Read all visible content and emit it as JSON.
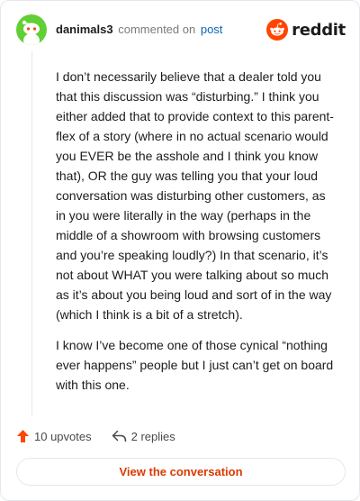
{
  "header": {
    "username": "danimals3",
    "action": "commented on",
    "post_link": "post",
    "brand": "reddit"
  },
  "comment": {
    "paragraphs": [
      "I don’t necessarily believe that a dealer told you that this discussion was “disturbing.” I think you either added that to provide context to this parent-flex of a story (where in no actual scenario would you EVER be the asshole and I think you know that), OR the guy was telling you that your loud conversation was disturbing other customers, as in you were literally in the way (perhaps in the middle of a showroom with browsing customers and you’re speaking loudly?) In that scenario, it’s not about WHAT you were talking about so much as it’s about you being loud and sort of in the way (which I think is a bit of a stretch).",
      "I know I’ve become one of those cynical “nothing ever happens” people but I just can’t get on board with this one."
    ]
  },
  "actions": {
    "upvotes": "10 upvotes",
    "replies": "2 replies"
  },
  "footer": {
    "view_button": "View the conversation"
  },
  "colors": {
    "accent": "#ff4500",
    "avatar": "#62cf35",
    "link": "#0a65b7",
    "button_text": "#d93a00"
  },
  "icons": [
    "snoo-avatar-icon",
    "reddit-logo-icon",
    "upvote-arrow-icon",
    "reply-arrow-icon"
  ]
}
